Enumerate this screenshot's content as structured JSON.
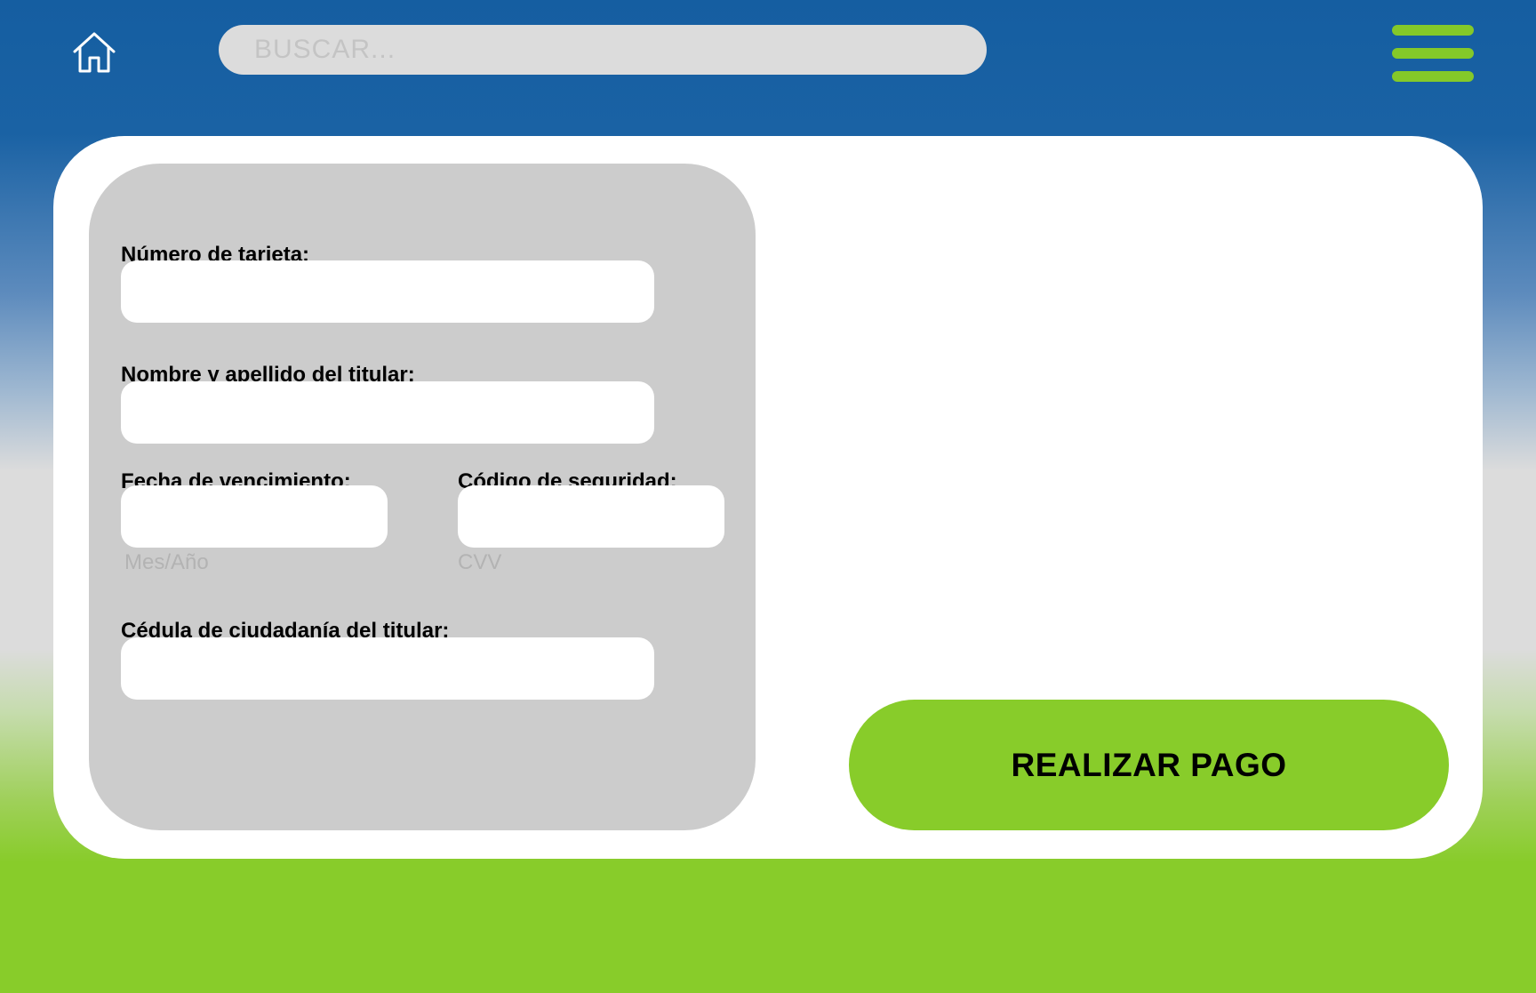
{
  "header": {
    "home_icon": "home-icon",
    "search": {
      "placeholder": "BUSCAR...",
      "value": ""
    },
    "menu_icon": "hamburger-menu-icon"
  },
  "form": {
    "card_number": {
      "label": "Número de tarjeta:",
      "value": ""
    },
    "holder_name": {
      "label": "Nombre y apellido del titular:",
      "value": ""
    },
    "expiry": {
      "label": "Fecha de vencimiento:",
      "value": "",
      "hint": "Mes/Año"
    },
    "security_code": {
      "label": "Código de seguridad:",
      "value": "",
      "hint": "CVV"
    },
    "id_number": {
      "label": "Cédula de ciudadanía del titular:",
      "value": ""
    }
  },
  "actions": {
    "pay_label": "REALIZAR PAGO"
  },
  "colors": {
    "header_blue": "#155ea1",
    "accent_green": "#88cc2a",
    "panel_gray": "#cccccc",
    "search_gray": "#dcdcdc"
  }
}
